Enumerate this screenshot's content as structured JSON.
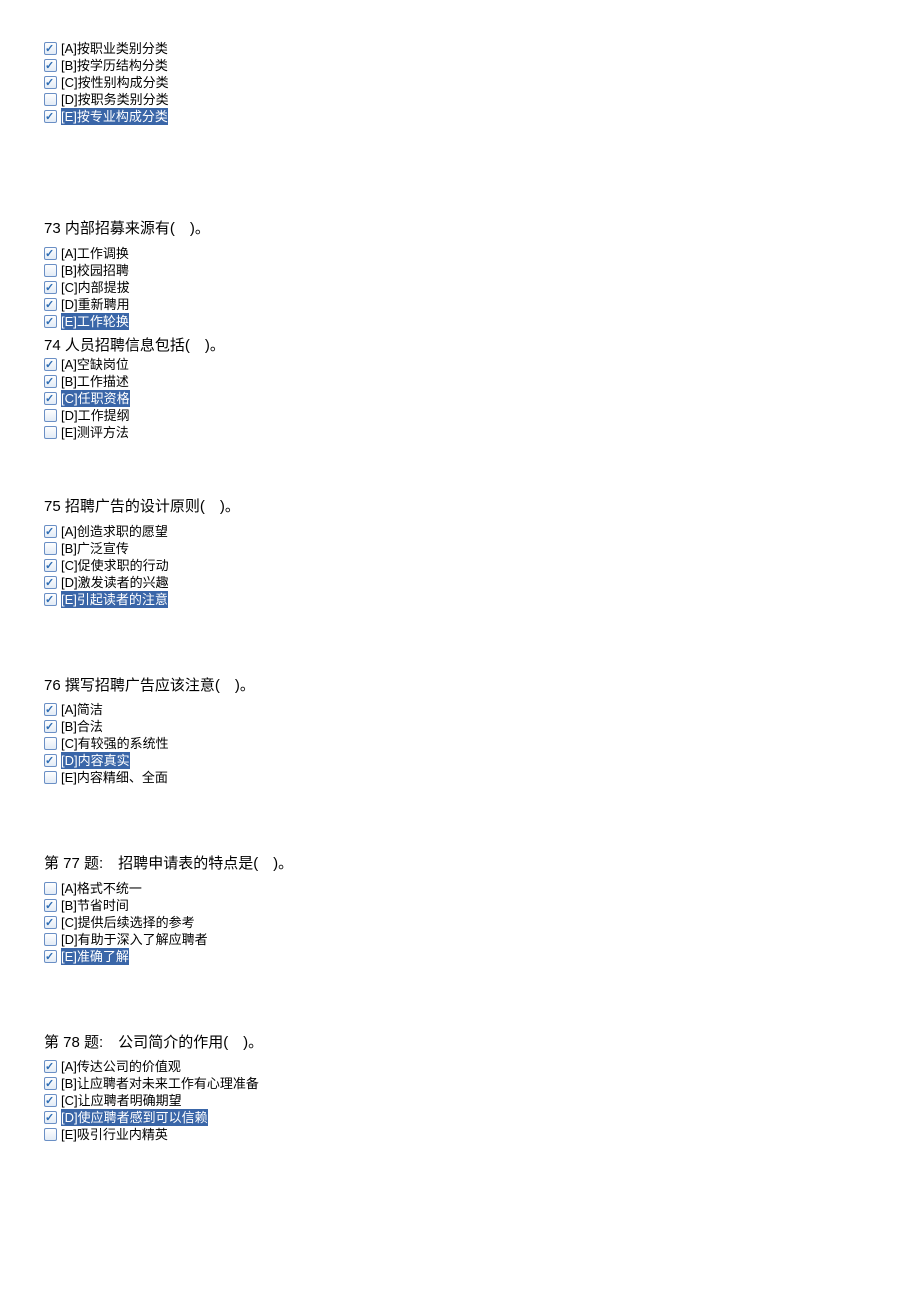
{
  "questions": [
    {
      "id": "q72",
      "text": "",
      "textClass": "hidden",
      "options": [
        {
          "label": "[A]按职业类别分类",
          "checked": true,
          "highlighted": false
        },
        {
          "label": "[B]按学历结构分类",
          "checked": true,
          "highlighted": false
        },
        {
          "label": "[C]按性别构成分类",
          "checked": true,
          "highlighted": false
        },
        {
          "label": "[D]按职务类别分类",
          "checked": false,
          "highlighted": false
        },
        {
          "label": "[E]按专业构成分类",
          "checked": true,
          "highlighted": true
        }
      ],
      "spacerAfter": "large"
    },
    {
      "id": "q73",
      "text": "73 内部招募来源有(　)。",
      "options": [
        {
          "label": "[A]工作调换",
          "checked": true,
          "highlighted": false
        },
        {
          "label": "[B]校园招聘",
          "checked": false,
          "highlighted": false
        },
        {
          "label": "[C]内部提拔",
          "checked": true,
          "highlighted": false
        },
        {
          "label": "[D]重新聘用",
          "checked": true,
          "highlighted": false
        },
        {
          "label": "[E]工作轮换",
          "checked": true,
          "highlighted": true
        }
      ],
      "preSpacer": "large",
      "spacerAfter": "none"
    },
    {
      "id": "q74",
      "text": "74 人员招聘信息包括(　)。",
      "textClass": "tight",
      "options": [
        {
          "label": "[A]空缺岗位",
          "checked": true,
          "highlighted": false
        },
        {
          "label": "[B]工作描述",
          "checked": true,
          "highlighted": false
        },
        {
          "label": "[C]任职资格",
          "checked": true,
          "highlighted": true
        },
        {
          "label": "[D]工作提纲",
          "checked": false,
          "highlighted": false
        },
        {
          "label": "[E]测评方法",
          "checked": false,
          "highlighted": false
        }
      ],
      "spacerAfter": "medium"
    },
    {
      "id": "q75",
      "text": "75  招聘广告的设计原则(　)。",
      "options": [
        {
          "label": "[A]创造求职的愿望",
          "checked": true,
          "highlighted": false
        },
        {
          "label": "[B]广泛宣传",
          "checked": false,
          "highlighted": false
        },
        {
          "label": "[C]促使求职的行动",
          "checked": true,
          "highlighted": false
        },
        {
          "label": "[D]激发读者的兴趣",
          "checked": true,
          "highlighted": false
        },
        {
          "label": "[E]引起读者的注意",
          "checked": true,
          "highlighted": true
        }
      ],
      "preSpacer": "small",
      "spacerAfter": "large"
    },
    {
      "id": "q76",
      "text": "76 撰写招聘广告应该注意(　)。",
      "options": [
        {
          "label": "[A]简洁",
          "checked": true,
          "highlighted": false
        },
        {
          "label": "[B]合法",
          "checked": true,
          "highlighted": false
        },
        {
          "label": "[C]有较强的系统性",
          "checked": false,
          "highlighted": false
        },
        {
          "label": "[D]内容真实",
          "checked": true,
          "highlighted": true
        },
        {
          "label": "[E]内容精细、全面",
          "checked": false,
          "highlighted": false
        }
      ],
      "preSpacer": "small",
      "spacerAfter": "large"
    },
    {
      "id": "q77",
      "text": "第 77 题:　招聘申请表的特点是(　)。",
      "options": [
        {
          "label": "[A]格式不统一",
          "checked": false,
          "highlighted": false
        },
        {
          "label": "[B]节省时间",
          "checked": true,
          "highlighted": false
        },
        {
          "label": "[C]提供后续选择的参考",
          "checked": true,
          "highlighted": false
        },
        {
          "label": "[D]有助于深入了解应聘者",
          "checked": false,
          "highlighted": false
        },
        {
          "label": "[E]准确了解",
          "checked": true,
          "highlighted": true
        }
      ],
      "preSpacer": "small",
      "spacerAfter": "large"
    },
    {
      "id": "q78",
      "text": "第 78 题:　公司简介的作用(　)。",
      "options": [
        {
          "label": "[A]传达公司的价值观",
          "checked": true,
          "highlighted": false
        },
        {
          "label": "[B]让应聘者对未来工作有心理准备",
          "checked": true,
          "highlighted": false
        },
        {
          "label": "[C]让应聘者明确期望",
          "checked": true,
          "highlighted": false
        },
        {
          "label": "[D]使应聘者感到可以信赖",
          "checked": true,
          "highlighted": true
        },
        {
          "label": "[E]吸引行业内精英",
          "checked": false,
          "highlighted": false
        }
      ],
      "preSpacer": "small",
      "spacerAfter": "none"
    }
  ]
}
